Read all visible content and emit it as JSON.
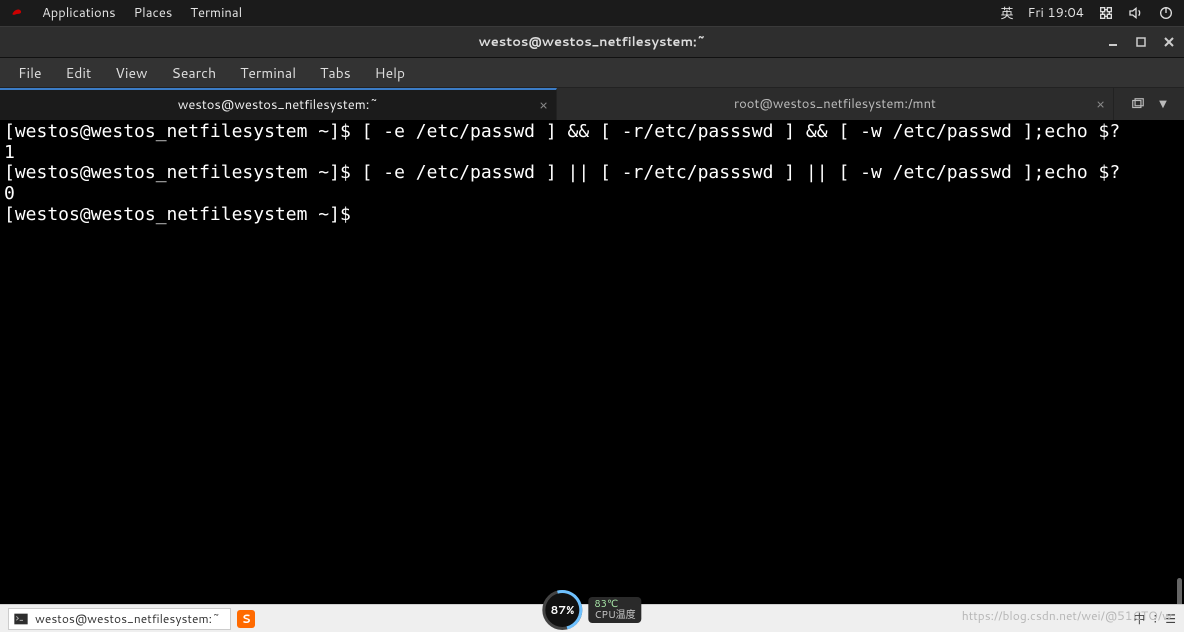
{
  "gnome": {
    "applications": "Applications",
    "places": "Places",
    "terminal": "Terminal",
    "ime": "英",
    "clock": "Fri 19:04"
  },
  "window": {
    "title": "westos@westos_netfilesystem:~"
  },
  "menus": [
    "File",
    "Edit",
    "View",
    "Search",
    "Terminal",
    "Tabs",
    "Help"
  ],
  "tabs": [
    {
      "label": "westos@westos_netfilesystem:~",
      "active": true
    },
    {
      "label": "root@westos_netfilesystem:/mnt",
      "active": false
    }
  ],
  "terminal": {
    "lines": [
      "[westos@westos_netfilesystem ~]$ [ -e /etc/passwd ] && [ -r/etc/passswd ] && [ -w /etc/passwd ];echo $?",
      "1",
      "[westos@westos_netfilesystem ~]$ [ -e /etc/passwd ] || [ -r/etc/passswd ] || [ -w /etc/passwd ];echo $?",
      "0",
      "[westos@westos_netfilesystem ~]$ "
    ]
  },
  "taskbar": {
    "title": "westos@westos_netfilesystem:~"
  },
  "cpu": {
    "pct": "87%",
    "temp": "83℃",
    "sub": "CPU温度"
  },
  "watermark": "https://blog.csdn.net/wei/@51CTO/w"
}
